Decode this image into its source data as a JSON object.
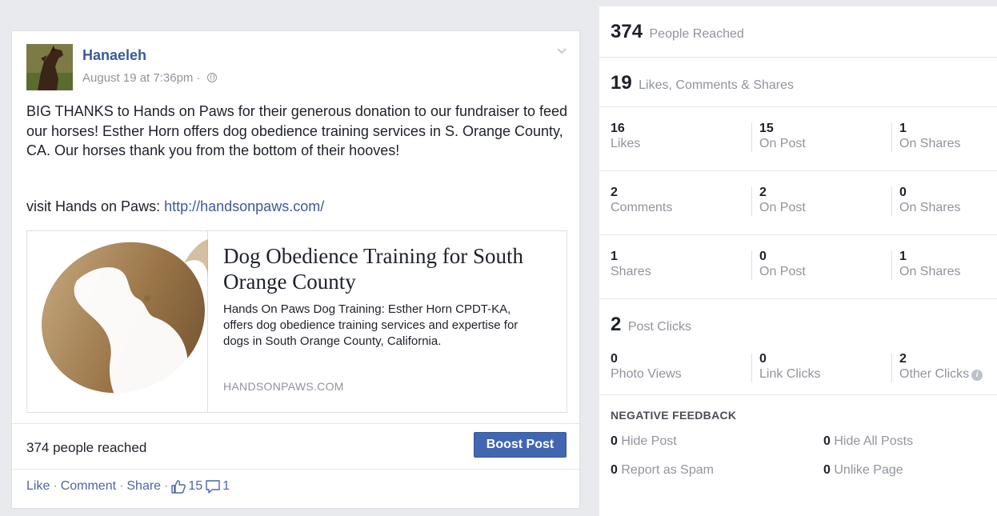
{
  "post": {
    "author": "Hanaeleh",
    "timestamp": "August 19 at 7:36pm ·",
    "privacy_icon": "globe-icon",
    "text": "BIG THANKS to Hands on Paws for their generous donation to our fundraiser to feed our horses! Esther Horn offers dog obedience training services in S. Orange County, CA. Our horses thank you from the bottom of their hooves!",
    "visit_prefix": "visit Hands on Paws: ",
    "visit_link": "http://handsonpaws.com/",
    "link_preview": {
      "title": "Dog Obedience Training for South Orange County",
      "description": "Hands On Paws Dog Training: Esther Horn CPDT-KA, offers dog obedience training services and expertise for dogs in South Orange County, California.",
      "domain": "HANDSONPAWS.COM"
    },
    "reach_text": "374 people reached",
    "boost_label": "Boost Post",
    "actions": {
      "like": "Like",
      "comment": "Comment",
      "share": "Share",
      "separator": "·",
      "like_count": "15",
      "comment_count": "1"
    }
  },
  "insights": {
    "people_reached": {
      "value": "374",
      "label": "People Reached"
    },
    "engagement": {
      "value": "19",
      "label": "Likes, Comments & Shares"
    },
    "likes": [
      {
        "value": "16",
        "label": "Likes"
      },
      {
        "value": "15",
        "label": "On Post"
      },
      {
        "value": "1",
        "label": "On Shares"
      }
    ],
    "comments": [
      {
        "value": "2",
        "label": "Comments"
      },
      {
        "value": "2",
        "label": "On Post"
      },
      {
        "value": "0",
        "label": "On Shares"
      }
    ],
    "shares": [
      {
        "value": "1",
        "label": "Shares"
      },
      {
        "value": "0",
        "label": "On Post"
      },
      {
        "value": "1",
        "label": "On Shares"
      }
    ],
    "post_clicks": {
      "value": "2",
      "label": "Post Clicks"
    },
    "clicks": [
      {
        "value": "0",
        "label": "Photo Views"
      },
      {
        "value": "0",
        "label": "Link Clicks"
      },
      {
        "value": "2",
        "label": "Other Clicks"
      }
    ],
    "info_glyph": "i",
    "negative_feedback": {
      "title": "NEGATIVE FEEDBACK",
      "items": [
        {
          "value": "0",
          "label": "Hide Post"
        },
        {
          "value": "0",
          "label": "Hide All Posts"
        },
        {
          "value": "0",
          "label": "Report as Spam"
        },
        {
          "value": "0",
          "label": "Unlike Page"
        }
      ]
    }
  },
  "colors": {
    "link_blue": "#3b5998",
    "boost_button": "#4267b2",
    "muted_text": "#90949c",
    "page_background": "#e9eaed"
  }
}
